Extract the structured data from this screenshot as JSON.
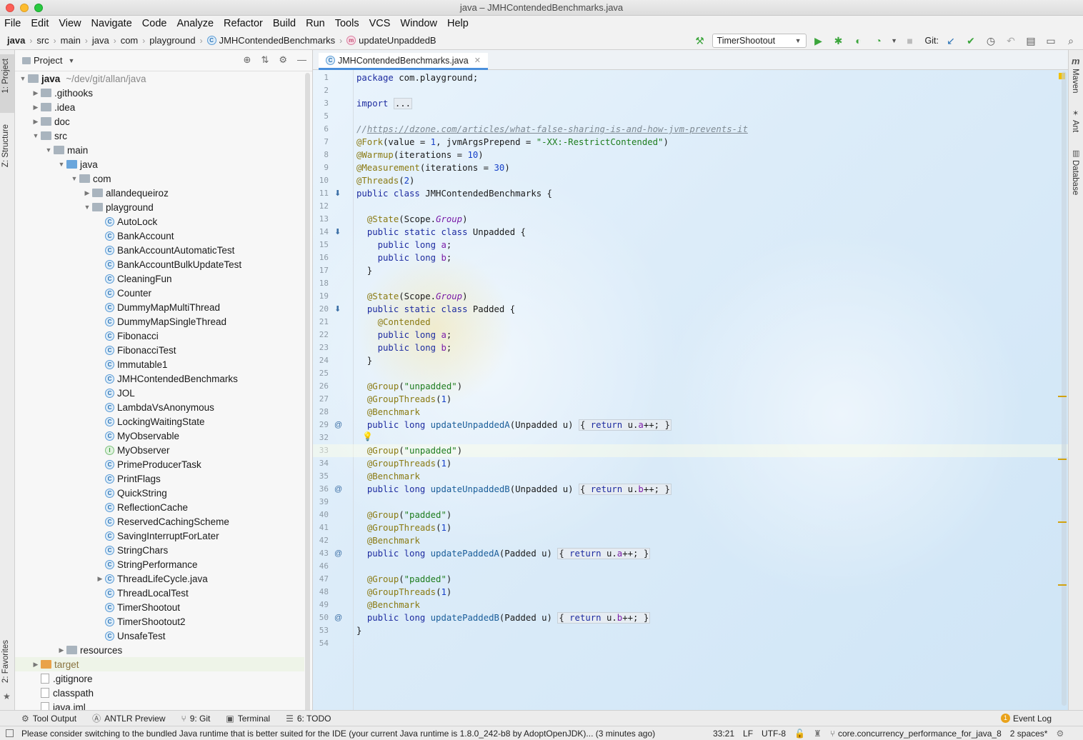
{
  "window": {
    "title": "java – JMHContendedBenchmarks.java"
  },
  "menu": [
    "File",
    "Edit",
    "View",
    "Navigate",
    "Code",
    "Analyze",
    "Refactor",
    "Build",
    "Run",
    "Tools",
    "VCS",
    "Window",
    "Help"
  ],
  "breadcrumbs": {
    "items": [
      "java",
      "src",
      "main",
      "java",
      "com",
      "playground",
      "JMHContendedBenchmarks",
      "updateUnpaddedB"
    ]
  },
  "toolbar": {
    "run_config": "TimerShootout",
    "git_label": "Git:"
  },
  "left_strip": {
    "project": "1: Project",
    "structure": "Z: Structure",
    "favorites": "2: Favorites"
  },
  "right_strip": {
    "maven": "Maven",
    "ant": "Ant",
    "database": "Database"
  },
  "project_panel": {
    "title": "Project"
  },
  "tree": [
    {
      "label": "java",
      "extra": "~/dev/git/allan/java",
      "indent": 0,
      "type": "folder",
      "arrow": "open",
      "bold": true
    },
    {
      "label": ".githooks",
      "indent": 1,
      "type": "folder",
      "arrow": "closed"
    },
    {
      "label": ".idea",
      "indent": 1,
      "type": "folder",
      "arrow": "closed"
    },
    {
      "label": "doc",
      "indent": 1,
      "type": "folder",
      "arrow": "closed"
    },
    {
      "label": "src",
      "indent": 1,
      "type": "folder",
      "arrow": "open"
    },
    {
      "label": "main",
      "indent": 2,
      "type": "folder",
      "arrow": "open"
    },
    {
      "label": "java",
      "indent": 3,
      "type": "folder-src",
      "arrow": "open"
    },
    {
      "label": "com",
      "indent": 4,
      "type": "folder",
      "arrow": "open"
    },
    {
      "label": "allandequeiroz",
      "indent": 5,
      "type": "folder",
      "arrow": "closed"
    },
    {
      "label": "playground",
      "indent": 5,
      "type": "folder",
      "arrow": "open"
    },
    {
      "label": "AutoLock",
      "indent": 6,
      "type": "class"
    },
    {
      "label": "BankAccount",
      "indent": 6,
      "type": "class"
    },
    {
      "label": "BankAccountAutomaticTest",
      "indent": 6,
      "type": "class"
    },
    {
      "label": "BankAccountBulkUpdateTest",
      "indent": 6,
      "type": "class"
    },
    {
      "label": "CleaningFun",
      "indent": 6,
      "type": "class"
    },
    {
      "label": "Counter",
      "indent": 6,
      "type": "class"
    },
    {
      "label": "DummyMapMultiThread",
      "indent": 6,
      "type": "class"
    },
    {
      "label": "DummyMapSingleThread",
      "indent": 6,
      "type": "class"
    },
    {
      "label": "Fibonacci",
      "indent": 6,
      "type": "class"
    },
    {
      "label": "FibonacciTest",
      "indent": 6,
      "type": "class"
    },
    {
      "label": "Immutable1",
      "indent": 6,
      "type": "class"
    },
    {
      "label": "JMHContendedBenchmarks",
      "indent": 6,
      "type": "class"
    },
    {
      "label": "JOL",
      "indent": 6,
      "type": "class"
    },
    {
      "label": "LambdaVsAnonymous",
      "indent": 6,
      "type": "class"
    },
    {
      "label": "LockingWaitingState",
      "indent": 6,
      "type": "class"
    },
    {
      "label": "MyObservable",
      "indent": 6,
      "type": "class"
    },
    {
      "label": "MyObserver",
      "indent": 6,
      "type": "interface"
    },
    {
      "label": "PrimeProducerTask",
      "indent": 6,
      "type": "class"
    },
    {
      "label": "PrintFlags",
      "indent": 6,
      "type": "class"
    },
    {
      "label": "QuickString",
      "indent": 6,
      "type": "class"
    },
    {
      "label": "ReflectionCache",
      "indent": 6,
      "type": "class"
    },
    {
      "label": "ReservedCachingScheme",
      "indent": 6,
      "type": "class"
    },
    {
      "label": "SavingInterruptForLater",
      "indent": 6,
      "type": "class"
    },
    {
      "label": "StringChars",
      "indent": 6,
      "type": "class"
    },
    {
      "label": "StringPerformance",
      "indent": 6,
      "type": "class"
    },
    {
      "label": "ThreadLifeCycle.java",
      "indent": 6,
      "type": "class",
      "arrow": "closed"
    },
    {
      "label": "ThreadLocalTest",
      "indent": 6,
      "type": "class"
    },
    {
      "label": "TimerShootout",
      "indent": 6,
      "type": "class"
    },
    {
      "label": "TimerShootout2",
      "indent": 6,
      "type": "class"
    },
    {
      "label": "UnsafeTest",
      "indent": 6,
      "type": "class"
    },
    {
      "label": "resources",
      "indent": 3,
      "type": "folder",
      "arrow": "closed"
    },
    {
      "label": "target",
      "indent": 1,
      "type": "folder-orange",
      "arrow": "closed",
      "muted": true
    },
    {
      "label": ".gitignore",
      "indent": 1,
      "type": "file"
    },
    {
      "label": "classpath",
      "indent": 1,
      "type": "file"
    },
    {
      "label": "java.iml",
      "indent": 1,
      "type": "file"
    }
  ],
  "editor": {
    "tab_label": "JMHContendedBenchmarks.java",
    "current_line": 33,
    "lines": [
      {
        "n": "1",
        "html": "<span class='kw'>package</span> com.playground;"
      },
      {
        "n": "2",
        "html": ""
      },
      {
        "n": "3",
        "html": "<span class='kw'>import</span> <span class='fold'>...</span>"
      },
      {
        "n": "5",
        "html": ""
      },
      {
        "n": "6",
        "html": "<span class='cm'>//</span><span class='url'>https://dzone.com/articles/what-false-sharing-is-and-how-jvm-prevents-it</span>"
      },
      {
        "n": "7",
        "html": "<span class='an'>@Fork</span>(value = <span class='nm'>1</span>, jvmArgsPrepend = <span class='st'>\"-XX:-RestrictContended\"</span>)"
      },
      {
        "n": "8",
        "html": "<span class='an'>@Warmup</span>(iterations = <span class='nm'>10</span>)"
      },
      {
        "n": "9",
        "html": "<span class='an'>@Measurement</span>(iterations = <span class='nm'>30</span>)"
      },
      {
        "n": "10",
        "html": "<span class='an'>@Threads</span>(<span class='nm'>2</span>)"
      },
      {
        "n": "11",
        "html": "<span class='kw'>public class</span> JMHContendedBenchmarks {",
        "g": "⬇"
      },
      {
        "n": "12",
        "html": ""
      },
      {
        "n": "13",
        "html": "  <span class='an'>@State</span>(Scope.<span class='it'>Group</span>)"
      },
      {
        "n": "14",
        "html": "  <span class='kw'>public static class</span> Unpadded {",
        "g": "⬇"
      },
      {
        "n": "15",
        "html": "    <span class='kw'>public long</span> <span class='fd'>a</span>;"
      },
      {
        "n": "16",
        "html": "    <span class='kw'>public long</span> <span class='fd'>b</span>;"
      },
      {
        "n": "17",
        "html": "  }"
      },
      {
        "n": "18",
        "html": ""
      },
      {
        "n": "19",
        "html": "  <span class='an'>@State</span>(Scope.<span class='it'>Group</span>)"
      },
      {
        "n": "20",
        "html": "  <span class='kw'>public static class</span> Padded {",
        "g": "⬇"
      },
      {
        "n": "21",
        "html": "    <span class='an'>@Contended</span>"
      },
      {
        "n": "22",
        "html": "    <span class='kw'>public long</span> <span class='fd'>a</span>;"
      },
      {
        "n": "23",
        "html": "    <span class='kw'>public long</span> <span class='fd'>b</span>;"
      },
      {
        "n": "24",
        "html": "  }"
      },
      {
        "n": "25",
        "html": ""
      },
      {
        "n": "26",
        "html": "  <span class='an'>@Group</span>(<span class='st'>\"unpadded\"</span>)"
      },
      {
        "n": "27",
        "html": "  <span class='an'>@GroupThreads</span>(<span class='nm'>1</span>)"
      },
      {
        "n": "28",
        "html": "  <span class='an'>@Benchmark</span>"
      },
      {
        "n": "29",
        "html": "  <span class='kw'>public long</span> <span class='md'>updateUnpaddedA</span>(Unpadded u) <span class='fold'>{ <span class='kw'>return</span> u.<span class='fd'>a</span>++; }</span>",
        "g": "@"
      },
      {
        "n": "32",
        "html": ""
      },
      {
        "n": "33",
        "html": "  <span class='an'>@Group</span>(<span class='st'>\"unpadded\"</span>)"
      },
      {
        "n": "34",
        "html": "  <span class='an'>@GroupThreads</span>(<span class='nm'>1</span>)"
      },
      {
        "n": "35",
        "html": "  <span class='an'>@Benchmark</span>"
      },
      {
        "n": "36",
        "html": "  <span class='kw'>public long</span> <span class='md'>updateUnpaddedB</span>(Unpadded u) <span class='fold'>{ <span class='kw'>return</span> u.<span class='fd'>b</span>++; }</span>",
        "g": "@"
      },
      {
        "n": "39",
        "html": ""
      },
      {
        "n": "40",
        "html": "  <span class='an'>@Group</span>(<span class='st'>\"padded\"</span>)"
      },
      {
        "n": "41",
        "html": "  <span class='an'>@GroupThreads</span>(<span class='nm'>1</span>)"
      },
      {
        "n": "42",
        "html": "  <span class='an'>@Benchmark</span>"
      },
      {
        "n": "43",
        "html": "  <span class='kw'>public long</span> <span class='md'>updatePaddedA</span>(Padded u) <span class='fold'>{ <span class='kw'>return</span> u.<span class='fd'>a</span>++; }</span>",
        "g": "@"
      },
      {
        "n": "46",
        "html": ""
      },
      {
        "n": "47",
        "html": "  <span class='an'>@Group</span>(<span class='st'>\"padded\"</span>)"
      },
      {
        "n": "48",
        "html": "  <span class='an'>@GroupThreads</span>(<span class='nm'>1</span>)"
      },
      {
        "n": "49",
        "html": "  <span class='an'>@Benchmark</span>"
      },
      {
        "n": "50",
        "html": "  <span class='kw'>public long</span> <span class='md'>updatePaddedB</span>(Padded u) <span class='fold'>{ <span class='kw'>return</span> u.<span class='fd'>b</span>++; }</span>",
        "g": "@"
      },
      {
        "n": "53",
        "html": "}"
      },
      {
        "n": "54",
        "html": ""
      }
    ]
  },
  "bottom_tabs": [
    {
      "label": "Tool Output",
      "icon": "tool-output-icon"
    },
    {
      "label": "ANTLR Preview",
      "icon": "antlr-icon"
    },
    {
      "label": "9: Git",
      "icon": "git-icon"
    },
    {
      "label": "Terminal",
      "icon": "terminal-icon"
    },
    {
      "label": "6: TODO",
      "icon": "todo-icon"
    }
  ],
  "event_log": {
    "label": "Event Log",
    "count": "1"
  },
  "status": {
    "message": "Please consider switching to the bundled Java runtime that is better suited for the IDE (your current Java runtime is 1.8.0_242-b8 by AdoptOpenJDK)... (3 minutes ago)",
    "position": "33:21",
    "line_sep": "LF",
    "encoding": "UTF-8",
    "branch": "core.concurrency_performance_for_java_8",
    "indent": "2 spaces*"
  },
  "colors": {
    "accent": "#4a8fdc",
    "run_green": "#3ba53b",
    "marker": "#d1a20f"
  }
}
